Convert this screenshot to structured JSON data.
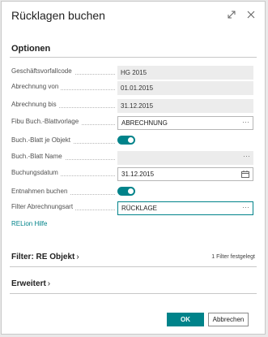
{
  "dialog": {
    "title": "Rücklagen buchen"
  },
  "sections": {
    "optionen": "Optionen",
    "filter_re_objekt": "Filter: RE Objekt",
    "filter_count": "1 Filter festgelegt",
    "erweitert": "Erweitert"
  },
  "fields": [
    {
      "label": "Geschäftsvorfallcode",
      "value": "HG 2015"
    },
    {
      "label": "Abrechnung von",
      "value": "01.01.2015"
    },
    {
      "label": "Abrechnung bis",
      "value": "31.12.2015"
    },
    {
      "label": "Fibu Buch.-Blattvorlage",
      "value": "ABRECHNUNG",
      "trail": "···"
    },
    {
      "label": "Buch.-Blatt je Objekt",
      "toggle": true
    },
    {
      "label": "Buch.-Blatt Name",
      "value": "",
      "trail": "···"
    },
    {
      "label": "Buchungsdatum",
      "value": "31.12.2015"
    },
    {
      "label": "Entnahmen buchen",
      "toggle": true
    },
    {
      "label": "Filter Abrechnungsart",
      "value": "RÜCKLAGE",
      "trail": "···"
    }
  ],
  "link": "RELion Hilfe",
  "buttons": {
    "ok": "OK",
    "cancel": "Abbrechen"
  },
  "colors": {
    "accent": "#00838a"
  }
}
